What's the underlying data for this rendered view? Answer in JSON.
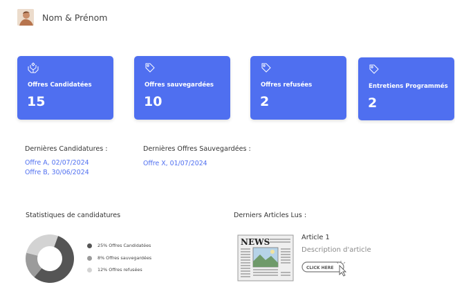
{
  "user": {
    "name": "Nom & Prénom"
  },
  "cards": [
    {
      "label": "Offres Candidatées",
      "value": "15",
      "icon": "hands-icon"
    },
    {
      "label": "Offres sauvegardées",
      "value": "10",
      "icon": "tag-icon"
    },
    {
      "label": "Offres refusées",
      "value": "2",
      "icon": "tag-icon"
    },
    {
      "label": "Entretiens Programmés",
      "value": "2",
      "icon": "tag-icon"
    }
  ],
  "recent_applications": {
    "title": "Dernières Candidatures :",
    "items": [
      "Offre A, 02/07/2024",
      "Offre B, 30/06/2024"
    ]
  },
  "recent_saved": {
    "title": "Dernières Offres Sauvegardées :",
    "items": [
      "Offre X, 01/07/2024"
    ]
  },
  "statistics": {
    "title": "Statistiques de candidatures",
    "legend": [
      {
        "label": "25% Offres Candidatées",
        "color": "#555555"
      },
      {
        "label": "8% Offres sauvegardées",
        "color": "#9b9b9b"
      },
      {
        "label": "12% Offres refusées",
        "color": "#d3d3d3"
      }
    ]
  },
  "chart_data": {
    "type": "pie",
    "categories": [
      "Offres Candidatées",
      "Offres sauvegardées",
      "Offres refusées"
    ],
    "values": [
      25,
      8,
      12
    ]
  },
  "articles": {
    "title": "Derniers Articles Lus :",
    "items": [
      {
        "title": "Article 1",
        "description": "Description d'article",
        "button": "CLICK HERE",
        "thumb_text": "NEWS"
      }
    ]
  },
  "colors": {
    "accent": "#4f6ff0",
    "text": "#333333",
    "muted": "#8a8a8a"
  }
}
